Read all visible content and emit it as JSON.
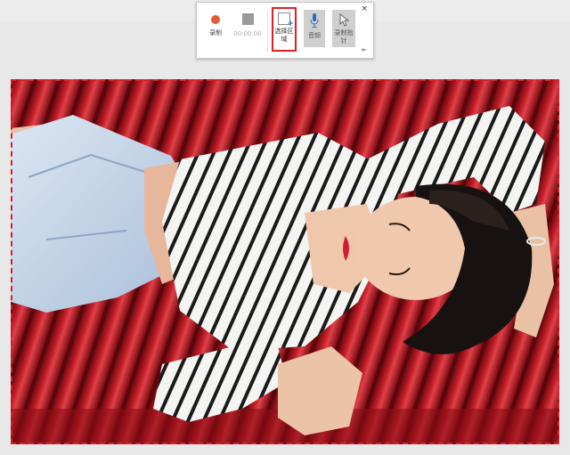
{
  "toolbar": {
    "record_label": "录制",
    "timer_text": "00:00:00",
    "select_area_label": "选择区域",
    "audio_label": "音频",
    "record_pointer_label": "录制指针",
    "close_symbol": "×",
    "pin_symbol": "⇤",
    "icons": {
      "record": "record-dot-icon",
      "stop": "stop-square-icon",
      "select": "select-area-icon",
      "audio": "microphone-icon",
      "pointer": "cursor-arrow-icon",
      "close": "close-icon",
      "pin": "dock-pin-icon"
    }
  },
  "colors": {
    "record": "#e05a3c",
    "selection_border": "#e02020",
    "selection_dashed": "#d8202a",
    "toggle_bg": "#cfcfcf",
    "bench_red": "#b81a24"
  }
}
